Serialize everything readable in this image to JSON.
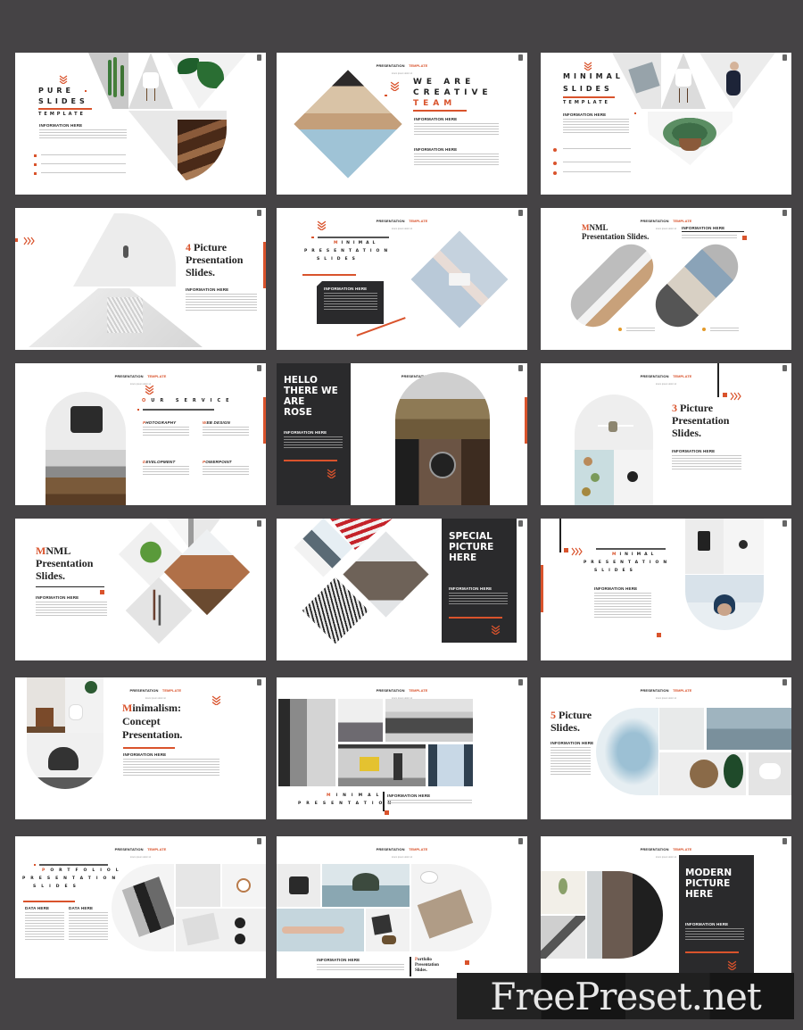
{
  "page": {
    "background_color": "#454345",
    "accent_color": "#d9532c",
    "dark_panel_color": "#2a2a2c"
  },
  "common": {
    "header_a": "PRESENTATION",
    "header_b": "TEMPLATE",
    "header_sub": "lorem ipsum dolor sit",
    "info_heading": "INFORMATION HERE",
    "data_heading": "DATA HERE"
  },
  "slides": [
    {
      "id": 1,
      "title_line1": "PURE",
      "title_line2": "SLIDES",
      "subtitle": "TEMPLATE",
      "info": "INFORMATION HERE",
      "bullets": 3,
      "images": [
        "cactus",
        "white-chair",
        "leaves",
        "wooden-stairs"
      ]
    },
    {
      "id": 2,
      "title_line1": "WE ARE",
      "title_line2": "CREATIVE",
      "title_line3": "TEAM",
      "info1": "INFORMATION HERE",
      "info2": "INFORMATION HERE",
      "images": [
        "woman-portrait"
      ]
    },
    {
      "id": 3,
      "title_line1": "MINIMAL",
      "title_line2": "SLIDES",
      "subtitle": "TEMPLATE",
      "info": "INFORMATION HERE",
      "bullets": 3,
      "images": [
        "notebook",
        "white-chair",
        "woman-lying",
        "potted-plant"
      ]
    },
    {
      "id": 4,
      "title_number": "4",
      "title_rest": "Picture",
      "title_line2": "Presentation",
      "title_line3": "Slides.",
      "info": "INFORMATION HERE",
      "images": [
        "person-in-fog",
        "white-architecture"
      ]
    },
    {
      "id": 5,
      "title_first": "M",
      "title_line1": "INIMAL",
      "title_line2": "PRESENTATION",
      "title_line3": "SLIDES",
      "info": "INFORMATION HERE",
      "images": [
        "white-jeep"
      ]
    },
    {
      "id": 6,
      "title_first": "M",
      "title_line1": "NML",
      "title_line2": "Presentation Slides.",
      "info": "INFORMATION HERE",
      "images": [
        "chair-closeup",
        "person-with-book"
      ]
    },
    {
      "id": 7,
      "title_first": "O",
      "title_line1": "UR SERVICE",
      "services": [
        {
          "first": "P",
          "rest": "HOTOGRAPHY"
        },
        {
          "first": "W",
          "rest": "EB DESIGN"
        },
        {
          "first": "D",
          "rest": "EVELOPMENT"
        },
        {
          "first": "P",
          "rest": "OWERPOINT"
        }
      ],
      "images": [
        "typewriter",
        "mountain"
      ]
    },
    {
      "id": 8,
      "title_lines": [
        "HELLO",
        "THERE WE",
        "ARE",
        "ROSE"
      ],
      "info": "INFORMATION HERE",
      "images": [
        "couple-landscape",
        "wristwatch"
      ]
    },
    {
      "id": 9,
      "title_number": "3",
      "title_rest": "Picture",
      "title_line2": "Presentation",
      "title_line3": "Slides.",
      "info": "INFORMATION HERE",
      "images": [
        "desk-chair",
        "succulents",
        "coffee-cup"
      ]
    },
    {
      "id": 10,
      "title_first": "M",
      "title_line1": "NML",
      "title_line2": "Presentation",
      "title_line3": "Slides.",
      "info": "INFORMATION HERE",
      "images": [
        "hanging-plant",
        "horse",
        "stationery",
        "doorway"
      ]
    },
    {
      "id": 11,
      "title_lines": [
        "SPECIAL",
        "PICTURE",
        "HERE"
      ],
      "info": "INFORMATION HERE",
      "images": [
        "snowy-mountain",
        "red-stripes",
        "deer",
        "pattern"
      ]
    },
    {
      "id": 12,
      "title_first": "M",
      "title_line1": "INIMAL",
      "title_line2": "PRESENTATION",
      "title_line3": "SLIDES",
      "info": "INFORMATION HERE",
      "images": [
        "camera",
        "lens",
        "man-with-hat"
      ]
    },
    {
      "id": 13,
      "title_first": "M",
      "title_line1": "inimalism:",
      "title_line2": "Concept",
      "title_line3": "Presentation.",
      "info": "INFORMATION HERE",
      "images": [
        "stool-interior",
        "black-chair"
      ]
    },
    {
      "id": 14,
      "title_first": "M",
      "title_line1": "INIMAL",
      "title_line2": "PRESENTATION",
      "info": "INFORMATION HERE",
      "images": [
        "face-blur",
        "city-fog",
        "pier-posts",
        "subway-person",
        "architecture-symmetry"
      ]
    },
    {
      "id": 15,
      "title_number": "5",
      "title_rest": "Picture",
      "title_line2": "Slides.",
      "info": "INFORMATION HERE",
      "images": [
        "flowers",
        "flowers-hand",
        "lake-boat",
        "wooden-tray",
        "monstera",
        "white-chair"
      ]
    },
    {
      "id": 16,
      "title_first": "P",
      "title_line1": "ORTFOLIOL",
      "title_line2": "PRESENTATION",
      "title_line3": "SLIDES",
      "data1": "DATA HERE",
      "data2": "DATA HERE",
      "images": [
        "books",
        "plant-desk",
        "clock",
        "magazine"
      ]
    },
    {
      "id": 17,
      "title_first": "P",
      "title_line1": "ortfolio",
      "title_line2": "Presentation",
      "title_line3": "Slides.",
      "info": "INFORMATION HERE",
      "images": [
        "typewriter",
        "island",
        "coffee",
        "magazine-portrait",
        "wristwatch-arm",
        "clothes"
      ]
    },
    {
      "id": 18,
      "title_lines": [
        "MODERN",
        "PICTURE",
        "HERE"
      ],
      "info": "INFORMATION HERE",
      "images": [
        "plant-sprig",
        "architecture",
        "woman-profile"
      ]
    }
  ],
  "watermark": {
    "text": "FreePreset.net"
  }
}
